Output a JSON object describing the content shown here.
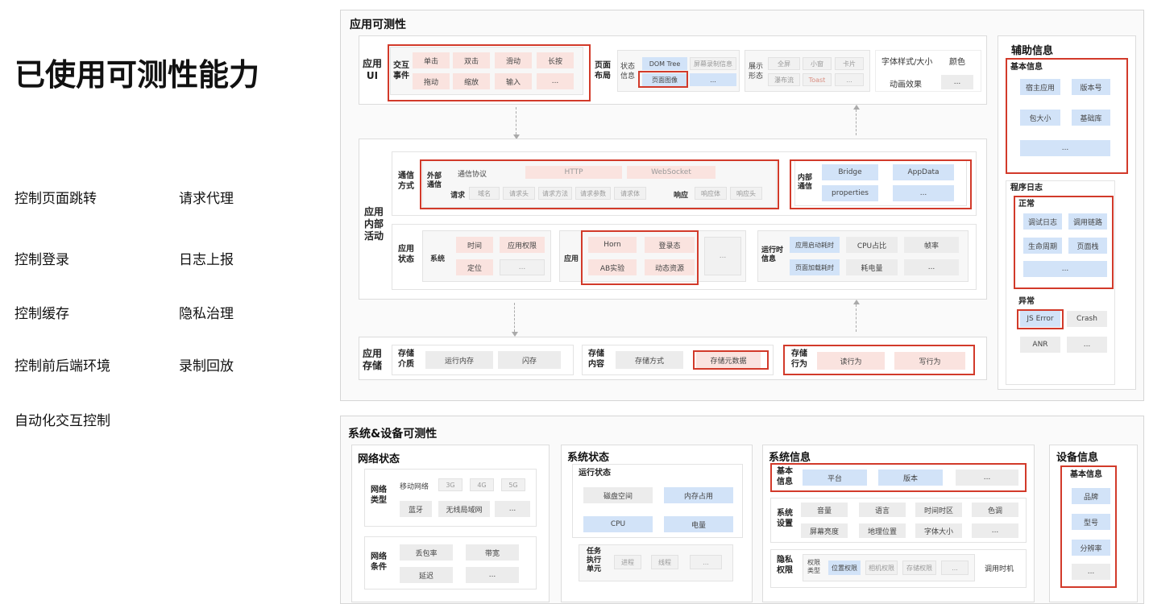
{
  "left": {
    "title": "已使用可测性能力",
    "items": [
      "控制页面跳转",
      "请求代理",
      "控制登录",
      "日志上报",
      "控制缓存",
      "隐私治理",
      "控制前后端环境",
      "录制回放",
      "自动化交互控制"
    ]
  },
  "app": {
    "title": "应用可测性",
    "ui": {
      "label": "应用\nUI",
      "interact_label": "交互\n事件",
      "interact": [
        "单击",
        "双击",
        "滑动",
        "长按",
        "拖动",
        "缩放",
        "输入",
        "..."
      ],
      "layout_label": "页面\n布局",
      "state_label": "状态\n信息",
      "state": [
        "DOM Tree",
        "屏幕录制信息",
        "页面图像",
        "..."
      ],
      "form_label": "展示\n形态",
      "form": [
        "全屏",
        "小窗",
        "卡片",
        "瀑布流",
        "Toast",
        "..."
      ],
      "style": [
        "字体样式/大小",
        "颜色",
        "动画效果",
        "..."
      ]
    },
    "internal": {
      "label": "应用\n内部\n活动",
      "comm_label": "通信\n方式",
      "ext_label": "外部\n通信",
      "protocol_label": "通信协议",
      "protocols": [
        "HTTP",
        "WebSocket"
      ],
      "request_label": "请求",
      "request": [
        "域名",
        "请求头",
        "请求方法",
        "请求参数",
        "请求体"
      ],
      "response_label": "响应",
      "response": [
        "响应体",
        "响应头"
      ],
      "int_comm_label": "内部\n通信",
      "int_comm": [
        "Bridge",
        "AppData",
        "properties",
        "..."
      ],
      "state_label": "应用\n状态",
      "system_label": "系统",
      "system": [
        "时间",
        "应用权限",
        "定位",
        "..."
      ],
      "app_label": "应用",
      "app": [
        "Horn",
        "登录态",
        "AB实验",
        "动态资源",
        "..."
      ],
      "runtime_label": "运行时\n信息",
      "runtime": [
        "应用启动耗时",
        "CPU占比",
        "帧率",
        "页面加载耗时",
        "耗电量",
        "..."
      ]
    },
    "storage": {
      "label": "应用\n存储",
      "medium_label": "存储\n介质",
      "medium": [
        "运行内存",
        "闪存"
      ],
      "content_label": "存储\n内容",
      "content": [
        "存储方式",
        "存储元数据"
      ],
      "behavior_label": "存储\n行为",
      "behavior": [
        "读行为",
        "写行为"
      ]
    }
  },
  "aux": {
    "title": "辅助信息",
    "basic_label": "基本信息",
    "basic": [
      "宿主应用",
      "版本号",
      "包大小",
      "基础库",
      "..."
    ],
    "log_label": "程序日志",
    "normal_label": "正常",
    "normal": [
      "调试日志",
      "调用链路",
      "生命周期",
      "页面栈",
      "..."
    ],
    "error_label": "异常",
    "error": [
      "JS Error",
      "Crash",
      "ANR",
      "..."
    ]
  },
  "system": {
    "title": "系统&设备可测性",
    "network": {
      "title": "网络状态",
      "type_label": "网络\n类型",
      "mobile_label": "移动网络",
      "mobile": [
        "3G",
        "4G",
        "5G"
      ],
      "type_other": [
        "蓝牙",
        "无线局域网",
        "..."
      ],
      "cond_label": "网络\n条件",
      "cond": [
        "丢包率",
        "带宽",
        "延迟",
        "..."
      ]
    },
    "sys_state": {
      "title": "系统状态",
      "run_label": "运行状态",
      "run": [
        "磁盘空间",
        "内存占用",
        "CPU",
        "电量"
      ],
      "task_label": "任务\n执行\n单元",
      "task": [
        "进程",
        "线程",
        "..."
      ]
    },
    "sys_info": {
      "title": "系统信息",
      "basic_label": "基本\n信息",
      "basic": [
        "平台",
        "版本",
        "..."
      ],
      "settings_label": "系统\n设置",
      "settings": [
        "音量",
        "语言",
        "时间时区",
        "色调",
        "屏幕亮度",
        "地理位置",
        "字体大小",
        "..."
      ],
      "privacy_label": "隐私\n权限",
      "perm_type_label": "权限\n类型",
      "perm": [
        "位置权限",
        "相机权限",
        "存储权限",
        "..."
      ],
      "call_time": "调用时机"
    },
    "device": {
      "title": "设备信息",
      "basic_label": "基本信息",
      "basic": [
        "品牌",
        "型号",
        "分辨率",
        "..."
      ]
    }
  }
}
